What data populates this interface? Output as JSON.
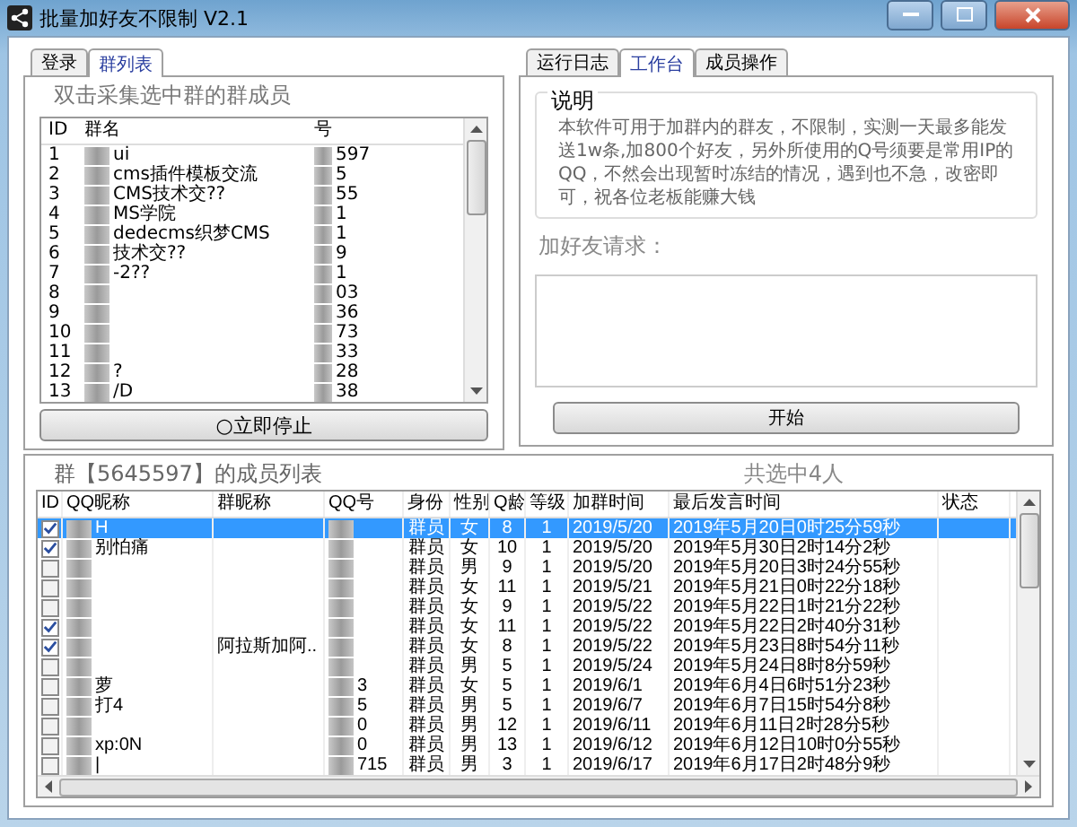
{
  "window": {
    "title": "批量加好友不限制 V2.1"
  },
  "left_panel": {
    "tabs": [
      {
        "label": "登录",
        "selected": false
      },
      {
        "label": "群列表",
        "selected": true
      }
    ],
    "hint": "双击采集选中群的群成员",
    "columns": [
      "ID",
      "群名",
      "号"
    ],
    "rows": [
      {
        "id": "1",
        "name": "ui",
        "number": "597"
      },
      {
        "id": "2",
        "name": "cms插件模板交流",
        "number": "5"
      },
      {
        "id": "3",
        "name": "CMS技术交??",
        "number": "55"
      },
      {
        "id": "4",
        "name": "MS学院",
        "number": "1"
      },
      {
        "id": "5",
        "name": "dedecms织梦CMS",
        "number": "1"
      },
      {
        "id": "6",
        "name": "技术交??",
        "number": "9"
      },
      {
        "id": "7",
        "name": "-2??",
        "number": "1"
      },
      {
        "id": "8",
        "name": "",
        "number": "03"
      },
      {
        "id": "9",
        "name": "",
        "number": "36"
      },
      {
        "id": "10",
        "name": "",
        "number": "73"
      },
      {
        "id": "11",
        "name": "",
        "number": "33"
      },
      {
        "id": "12",
        "name": "?",
        "number": "28"
      },
      {
        "id": "13",
        "name": "/D",
        "number": "38"
      }
    ],
    "stop_button": "○立即停止"
  },
  "right_panel": {
    "tabs": [
      {
        "label": "运行日志",
        "selected": false
      },
      {
        "label": "工作台",
        "selected": true
      },
      {
        "label": "成员操作",
        "selected": false
      }
    ],
    "notice_title": "说明",
    "notice": "本软件可用于加群内的群友，不限制，实测一天最多能发送1w条,加800个好友，另外所使用的Q号须要是常用IP的QQ，不然会出现暂时冻结的情况，遇到也不急，改密即可，祝各位老板能赚大钱",
    "request_label": "加好友请求：",
    "start_button": "开始"
  },
  "members": {
    "title": "群【5645597】的成员列表",
    "selected_count": "共选中4人",
    "columns": [
      "ID",
      "QQ昵称",
      "群昵称",
      "QQ号",
      "身份",
      "性别",
      "Q龄",
      "等级",
      "加群时间",
      "最后发言时间",
      "状态"
    ],
    "rows": [
      {
        "checked": true,
        "selected": true,
        "nick": "H",
        "group_nick": "",
        "qq": "",
        "role": "群员",
        "gender": "女",
        "age": "8",
        "level": "1",
        "joined": "2019/5/20",
        "last": "2019年5月20日0时25分59秒"
      },
      {
        "checked": true,
        "selected": false,
        "nick": "别怕痛",
        "group_nick": "",
        "qq": "",
        "role": "群员",
        "gender": "女",
        "age": "10",
        "level": "1",
        "joined": "2019/5/20",
        "last": "2019年5月30日2时14分2秒"
      },
      {
        "checked": false,
        "selected": false,
        "nick": "",
        "group_nick": "",
        "qq": "",
        "role": "群员",
        "gender": "男",
        "age": "9",
        "level": "1",
        "joined": "2019/5/20",
        "last": "2019年5月20日3时24分55秒"
      },
      {
        "checked": false,
        "selected": false,
        "nick": "",
        "group_nick": "",
        "qq": "",
        "role": "群员",
        "gender": "女",
        "age": "11",
        "level": "1",
        "joined": "2019/5/21",
        "last": "2019年5月21日0时22分18秒"
      },
      {
        "checked": false,
        "selected": false,
        "nick": "",
        "group_nick": "",
        "qq": "",
        "role": "群员",
        "gender": "女",
        "age": "9",
        "level": "1",
        "joined": "2019/5/22",
        "last": "2019年5月22日1时21分22秒"
      },
      {
        "checked": true,
        "selected": false,
        "nick": "",
        "group_nick": "",
        "qq": "",
        "role": "群员",
        "gender": "女",
        "age": "11",
        "level": "1",
        "joined": "2019/5/22",
        "last": "2019年5月22日2时40分31秒"
      },
      {
        "checked": true,
        "selected": false,
        "nick": "",
        "group_nick": "阿拉斯加阿..",
        "qq": "",
        "role": "群员",
        "gender": "女",
        "age": "8",
        "level": "1",
        "joined": "2019/5/22",
        "last": "2019年5月23日8时54分11秒"
      },
      {
        "checked": false,
        "selected": false,
        "nick": "",
        "group_nick": "",
        "qq": "",
        "role": "群员",
        "gender": "男",
        "age": "5",
        "level": "1",
        "joined": "2019/5/24",
        "last": "2019年5月24日8时8分59秒"
      },
      {
        "checked": false,
        "selected": false,
        "nick": "萝",
        "group_nick": "",
        "qq": "3",
        "role": "群员",
        "gender": "女",
        "age": "5",
        "level": "1",
        "joined": "2019/6/1",
        "last": "2019年6月4日6时51分23秒"
      },
      {
        "checked": false,
        "selected": false,
        "nick": "打4",
        "group_nick": "",
        "qq": "5",
        "role": "群员",
        "gender": "男",
        "age": "5",
        "level": "1",
        "joined": "2019/6/7",
        "last": "2019年6月7日15时54分8秒"
      },
      {
        "checked": false,
        "selected": false,
        "nick": "",
        "group_nick": "",
        "qq": "0",
        "role": "群员",
        "gender": "男",
        "age": "12",
        "level": "1",
        "joined": "2019/6/11",
        "last": "2019年6月11日2时28分5秒"
      },
      {
        "checked": false,
        "selected": false,
        "nick": "xp:0N",
        "group_nick": "",
        "qq": "0",
        "role": "群员",
        "gender": "男",
        "age": "13",
        "level": "1",
        "joined": "2019/6/12",
        "last": "2019年6月12日10时0分55秒"
      },
      {
        "checked": false,
        "selected": false,
        "nick": "|",
        "group_nick": "",
        "qq": "715",
        "role": "群员",
        "gender": "男",
        "age": "3",
        "level": "1",
        "joined": "2019/6/17",
        "last": "2019年6月17日2时48分9秒"
      }
    ]
  }
}
